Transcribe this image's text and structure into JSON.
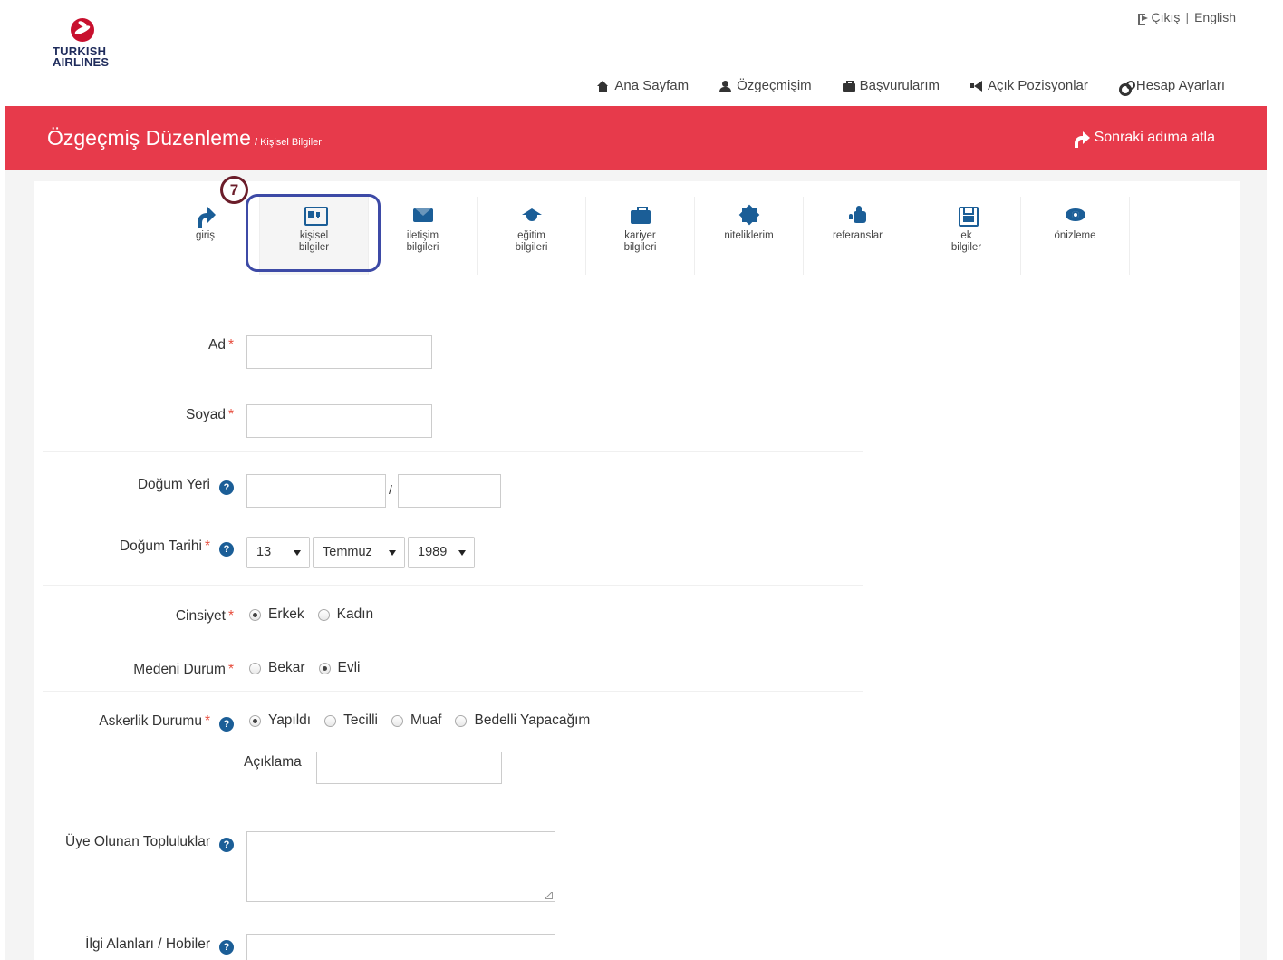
{
  "header": {
    "logo_line1": "TURKISH",
    "logo_line2": "AIRLINES",
    "exit_label": "Çıkış",
    "separator": "|",
    "language_label": "English"
  },
  "nav": {
    "home": "Ana Sayfam",
    "resume": "Özgeçmişim",
    "applications": "Başvurularım",
    "open_positions": "Açık Pozisyonlar",
    "account_settings": "Hesap Ayarları"
  },
  "band": {
    "title": "Özgeçmiş Düzenleme",
    "breadcrumb": "/ Kişisel Bilgiler",
    "skip_label": "Sonraki adıma atla"
  },
  "steps": [
    {
      "line1": "giriş",
      "line2": "",
      "icon": "share-icon"
    },
    {
      "line1": "kişisel",
      "line2": "bilgiler",
      "icon": "id-card-icon"
    },
    {
      "line1": "iletişim",
      "line2": "bilgileri",
      "icon": "envelope-icon"
    },
    {
      "line1": "eğitim",
      "line2": "bilgileri",
      "icon": "graduation-cap-icon"
    },
    {
      "line1": "kariyer",
      "line2": "bilgileri",
      "icon": "briefcase-icon"
    },
    {
      "line1": "niteliklerim",
      "line2": "",
      "icon": "certificate-icon"
    },
    {
      "line1": "referanslar",
      "line2": "",
      "icon": "thumbs-up-icon"
    },
    {
      "line1": "ek",
      "line2": "bilgiler",
      "icon": "save-icon"
    },
    {
      "line1": "önizleme",
      "line2": "",
      "icon": "eye-icon"
    }
  ],
  "annotation": {
    "badge": "7"
  },
  "form": {
    "required_mark": "*",
    "help_glyph": "?",
    "first_name_label": "Ad",
    "last_name_label": "Soyad",
    "birth_place_label": "Doğum Yeri",
    "birth_place_sep": "/",
    "birth_date_label": "Doğum Tarihi",
    "birth_day": "13",
    "birth_month": "Temmuz",
    "birth_year": "1989",
    "gender_label": "Cinsiyet",
    "gender_options": [
      "Erkek",
      "Kadın"
    ],
    "gender_selected": "Erkek",
    "marital_label": "Medeni Durum",
    "marital_options": [
      "Bekar",
      "Evli"
    ],
    "marital_selected": "Evli",
    "military_label": "Askerlik Durumu",
    "military_options": [
      "Yapıldı",
      "Tecilli",
      "Muaf",
      "Bedelli Yapacağım"
    ],
    "military_selected": "Yapıldı",
    "explanation_label": "Açıklama",
    "communities_label": "Üye Olunan Topluluklar",
    "hobbies_label": "İlgi Alanları / Hobiler"
  },
  "colors": {
    "brand_red": "#e73a4b",
    "step_icon_blue": "#1b5e97",
    "highlight_ring": "#3d4aa6",
    "badge": "#6b1d2a"
  }
}
